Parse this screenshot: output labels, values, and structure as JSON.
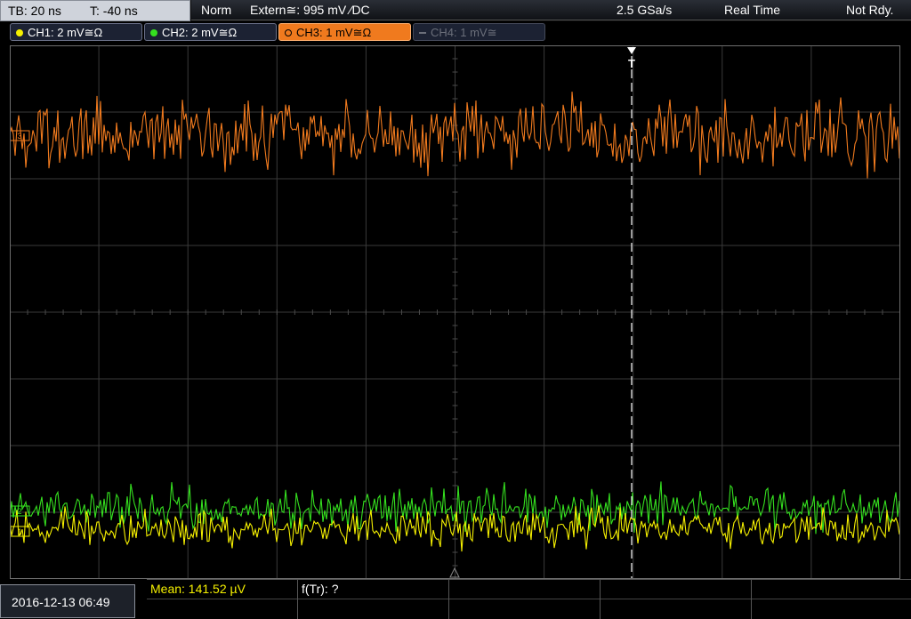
{
  "status": {
    "timebase": "TB: 20 ns",
    "trigger_offset": "T: -40 ns",
    "mode": "Norm",
    "trigger_source": "Extern≅: 995 mV ⁄DC",
    "sample_rate": "2.5 GSa/s",
    "acq_mode": "Real Time",
    "state": "Not Rdy."
  },
  "channels": [
    {
      "label": "CH1: 2 mV≅Ω",
      "color": "#f5f000",
      "active": true
    },
    {
      "label": "CH2: 2 mV≅Ω",
      "color": "#35e01f",
      "active": true
    },
    {
      "label": "CH3: 1 mV≅Ω",
      "color": "#f07a1e",
      "active": true,
      "selected": true
    },
    {
      "label": "CH4: 1 mV≅",
      "color": "#6b6f7a",
      "active": false
    }
  ],
  "markers": {
    "trigger": "T",
    "ch1": "1",
    "ch2": "2",
    "ch3": "3"
  },
  "measurement": {
    "mean": "Mean: 141.52 µV",
    "ftr": "f(Tr): ?"
  },
  "datetime": "2016-12-13 06:49"
}
